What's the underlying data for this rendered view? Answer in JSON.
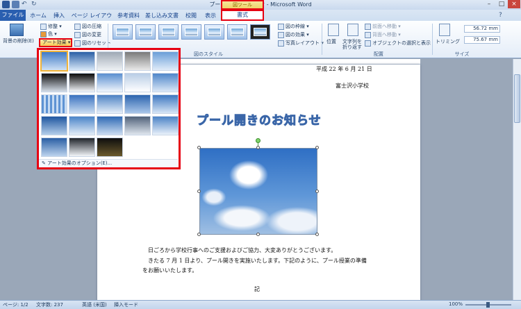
{
  "window": {
    "title": "プール開きのお知らせ - Microsoft Word"
  },
  "context_group": "図ツール",
  "tabs": {
    "file": "ファイル",
    "home": "ホーム",
    "insert": "挿入",
    "page_layout": "ページ レイアウト",
    "references": "参考資料",
    "mailings": "差し込み文書",
    "review": "校閲",
    "view": "表示",
    "format": "書式"
  },
  "ribbon": {
    "remove_bg": "背景の削除(E)",
    "adjust": {
      "correct": "修整",
      "color": "色",
      "art_effects": "アート効果",
      "compress": "図の圧縮",
      "change": "図の変更",
      "reset": "図のリセット"
    },
    "picture_styles_group": "図のスタイル",
    "picture_border": "図の枠線",
    "picture_effects": "図の効果",
    "picture_layout": "写真レイアウト",
    "arrange": {
      "position": "位置",
      "wrap_text_1": "文字列を",
      "wrap_text_2": "折り返す",
      "bring_forward": "前面へ移動",
      "send_backward": "背面へ移動",
      "selection_pane": "オブジェクトの選択と表示",
      "group_label": "配置"
    },
    "size": {
      "crop": "トリミング",
      "height": "56.72 mm",
      "width": "75.67 mm",
      "group_label": "サイズ"
    }
  },
  "art_effects_menu": {
    "options_label": "アート効果のオプション(E)..."
  },
  "document": {
    "date": "平成 22 年 6 月 21 日",
    "school": "富士沢小学校",
    "headline": "プール開きのお知らせ",
    "para1": "日ごろから学校行事へのご支援およびご協力、大変ありがとうございます。",
    "para2": "きたる 7 月 1 日より、プール開きを実施いたします。下記のように、プール授業の準備",
    "para3": "をお願いいたします。",
    "ki": "記"
  },
  "statusbar": {
    "page": "ページ: 1/2",
    "words": "文字数: 237",
    "lang": "英語 (米国)",
    "mode": "挿入モード",
    "zoom": "100%"
  },
  "colors": {
    "highlight": "#e60012",
    "file_tab": "#2a5fb0",
    "title_text": "#8fb4e4"
  }
}
